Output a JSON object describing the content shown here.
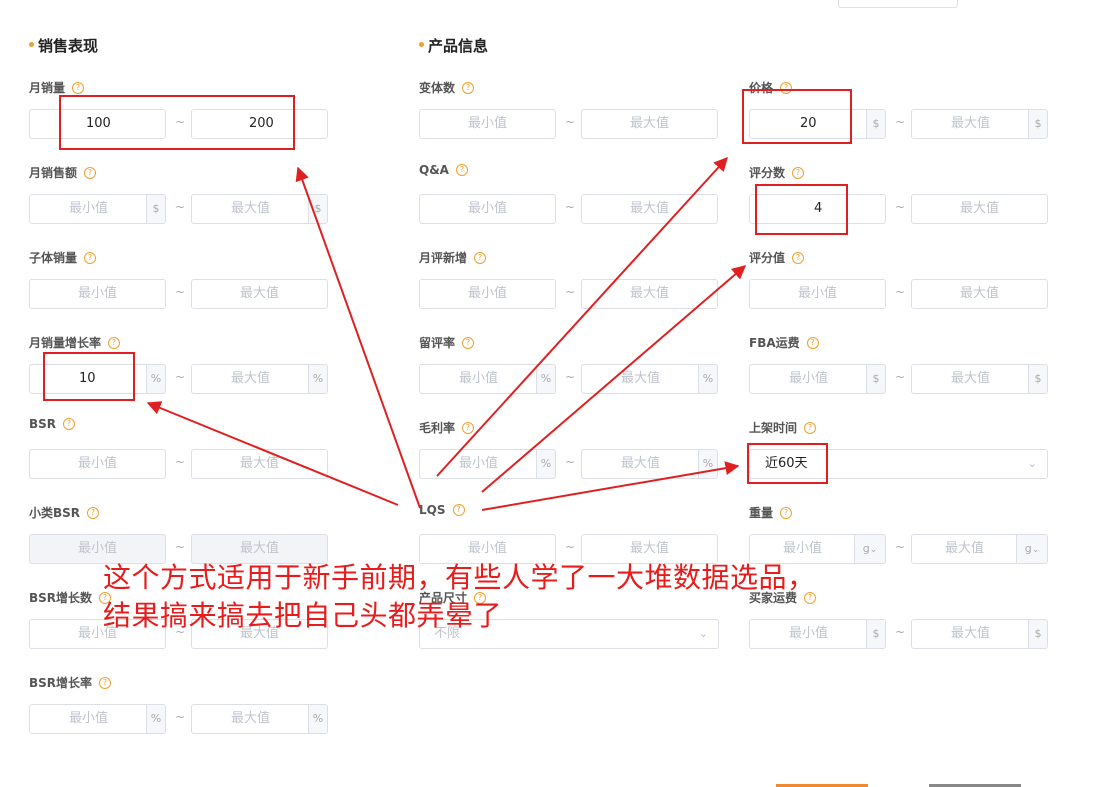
{
  "sections": {
    "sales": "销售表现",
    "product": "产品信息"
  },
  "help_glyph": "?",
  "tilde": "~",
  "placeholders": {
    "min": "最小值",
    "max": "最大值"
  },
  "units": {
    "dollar": "$",
    "percent": "%",
    "gram": "g"
  },
  "sales_fields": {
    "monthly_sales": {
      "label": "月销量",
      "min": "100",
      "max": "200"
    },
    "monthly_revenue": {
      "label": "月销售额"
    },
    "child_sales": {
      "label": "子体销量"
    },
    "sales_growth": {
      "label": "月销量增长率",
      "min": "10"
    },
    "bsr": {
      "label": "BSR"
    },
    "sub_bsr": {
      "label": "小类BSR"
    },
    "bsr_growth_count": {
      "label": "BSR增长数"
    },
    "bsr_growth_rate": {
      "label": "BSR增长率"
    }
  },
  "mid_fields": {
    "variants": {
      "label": "变体数"
    },
    "qa": {
      "label": "Q&A"
    },
    "monthly_new_reviews": {
      "label": "月评新增"
    },
    "review_retention": {
      "label": "留评率"
    },
    "gross_margin": {
      "label": "毛利率"
    },
    "lqs": {
      "label": "LQS"
    },
    "product_size": {
      "label": "产品尺寸",
      "value": "不限"
    }
  },
  "right_fields": {
    "price": {
      "label": "价格",
      "min": "20"
    },
    "rating_count": {
      "label": "评分数",
      "min": "4"
    },
    "rating_value": {
      "label": "评分值"
    },
    "fba_fee": {
      "label": "FBA运费"
    },
    "listing_time": {
      "label": "上架时间",
      "value": "近60天"
    },
    "weight": {
      "label": "重量"
    },
    "buyer_shipping": {
      "label": "买家运费"
    }
  },
  "annotation": {
    "line1": "这个方式适用于新手前期，有些人学了一大堆数据选品，",
    "line2": "结果搞来搞去把自己头都弄晕了"
  },
  "colors": {
    "accent": "#f0a030",
    "annotation_red": "#e81c1c"
  }
}
